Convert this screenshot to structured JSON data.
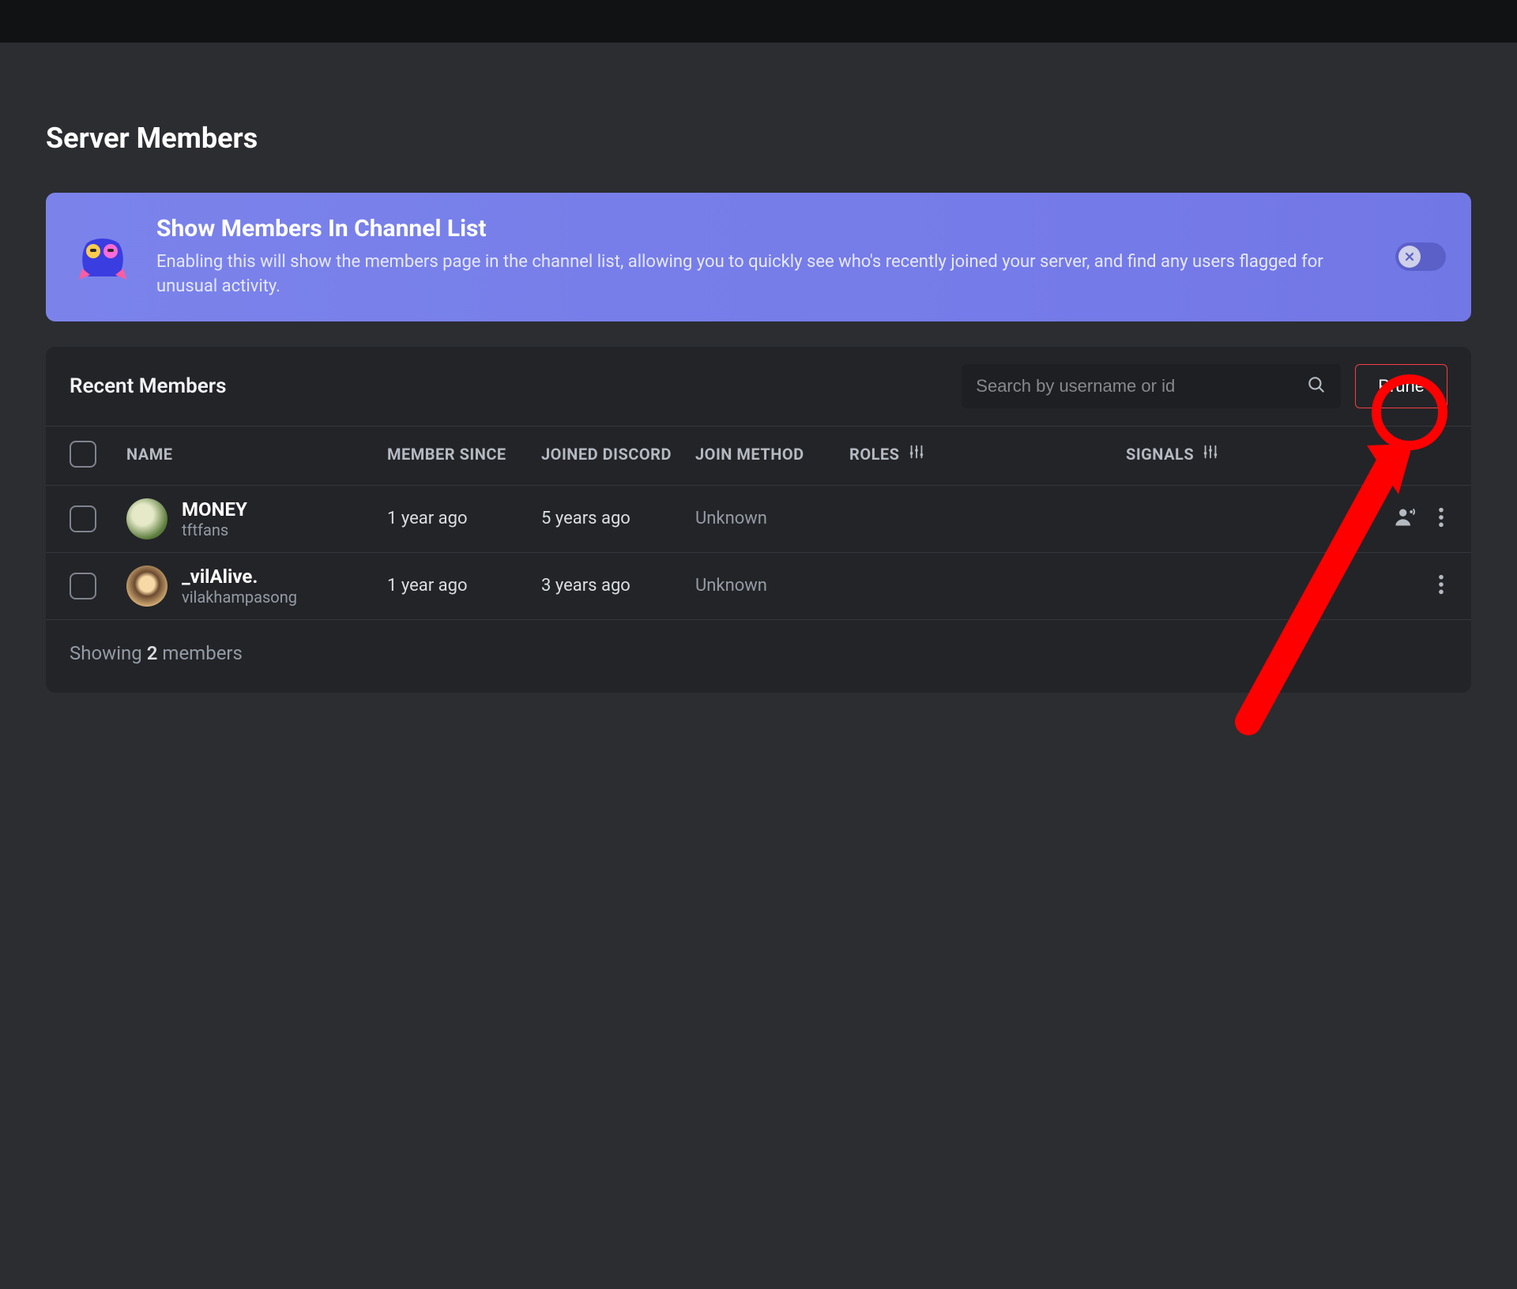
{
  "page": {
    "title": "Server Members"
  },
  "banner": {
    "title": "Show Members In Channel List",
    "description": "Enabling this will show the members page in the channel list, allowing you to quickly see who's recently joined your server, and find any users flagged for unusual activity.",
    "toggle_state": "off"
  },
  "panel": {
    "title": "Recent Members",
    "search_placeholder": "Search by username or id",
    "prune_label": "Prune"
  },
  "columns": {
    "name": "NAME",
    "member_since": "MEMBER SINCE",
    "joined_discord": "JOINED DISCORD",
    "join_method": "JOIN METHOD",
    "roles": "ROLES",
    "signals": "SIGNALS"
  },
  "members": [
    {
      "display_name": "MONEY",
      "username": "tftfans",
      "member_since": "1 year ago",
      "joined_discord": "5 years ago",
      "join_method": "Unknown",
      "has_signal": true
    },
    {
      "display_name": "_vilAlive.",
      "username": "vilakhampasong",
      "member_since": "1 year ago",
      "joined_discord": "3 years ago",
      "join_method": "Unknown",
      "has_signal": false
    }
  ],
  "footer": {
    "prefix": "Showing ",
    "count": "2",
    "suffix": " members"
  },
  "annotation": {
    "type": "circle-and-arrow",
    "target": "row-0-more-button",
    "color": "#ff0000"
  }
}
